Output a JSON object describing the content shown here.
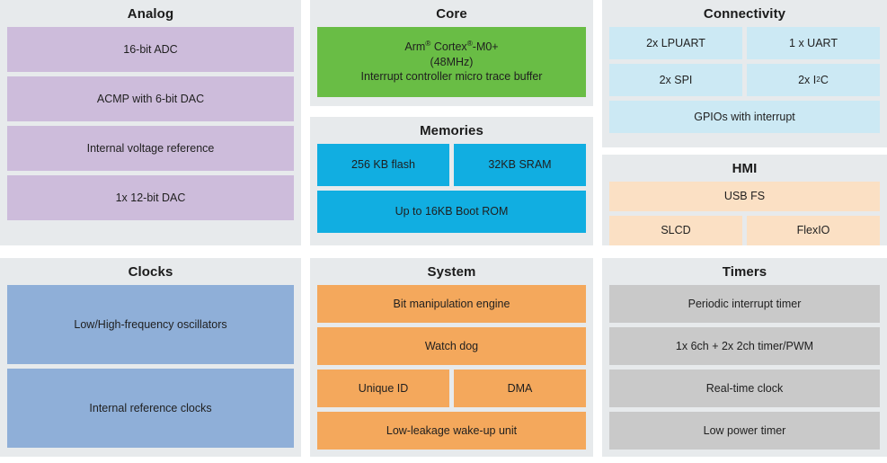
{
  "diagram": {
    "title": "MCU block diagram",
    "colors": {
      "panel_background": "#e7eaec",
      "page_background": "#ffffff",
      "analog": "#cdbcdb",
      "core": "#69bd45",
      "memories": "#11aee1",
      "connectivity": "#cce9f4",
      "hmi": "#fbe0c4",
      "clocks": "#8fafd8",
      "system": "#f4a85c",
      "timers": "#c9c9c9",
      "title_text": "#1b1b1b",
      "block_text": "#1f1f1f"
    }
  },
  "panels": {
    "analog": {
      "title": "Analog",
      "blocks": [
        {
          "label": "16-bit ADC"
        },
        {
          "label": "ACMP with 6-bit DAC"
        },
        {
          "label": "Internal voltage reference"
        },
        {
          "label": "1x 12-bit DAC"
        }
      ]
    },
    "core": {
      "title": "Core",
      "blocks": [
        {
          "line1_pre": "Arm",
          "line1_sup1": "®",
          "line1_mid": " Cortex",
          "line1_sup2": "®",
          "line1_post": "-M0+",
          "line2": "(48MHz)",
          "line3": "Interrupt controller micro trace buffer"
        }
      ]
    },
    "memories": {
      "title": "Memories",
      "blocks": [
        {
          "label": "256 KB flash"
        },
        {
          "label": "32KB SRAM"
        },
        {
          "label": "Up to 16KB Boot ROM"
        }
      ]
    },
    "connectivity": {
      "title": "Connectivity",
      "blocks": [
        {
          "label": "2x LPUART"
        },
        {
          "label": "1 x UART"
        },
        {
          "label": "2x SPI"
        },
        {
          "label_pre": "2x I",
          "label_sup": "2",
          "label_post": "C"
        },
        {
          "label": "GPIOs with interrupt"
        }
      ]
    },
    "hmi": {
      "title": "HMI",
      "blocks": [
        {
          "label": "USB FS"
        },
        {
          "label": "SLCD"
        },
        {
          "label": "FlexIO"
        }
      ]
    },
    "clocks": {
      "title": "Clocks",
      "blocks": [
        {
          "label": "Low/High-frequency oscillators"
        },
        {
          "label": "Internal reference clocks"
        }
      ]
    },
    "system": {
      "title": "System",
      "blocks": [
        {
          "label": "Bit manipulation engine"
        },
        {
          "label": "Watch dog"
        },
        {
          "label": "Unique ID"
        },
        {
          "label": "DMA"
        },
        {
          "label": "Low-leakage wake-up unit"
        }
      ]
    },
    "timers": {
      "title": "Timers",
      "blocks": [
        {
          "label": "Periodic interrupt timer"
        },
        {
          "label": "1x 6ch + 2x 2ch timer/PWM"
        },
        {
          "label": "Real-time clock"
        },
        {
          "label": "Low power timer"
        }
      ]
    }
  }
}
